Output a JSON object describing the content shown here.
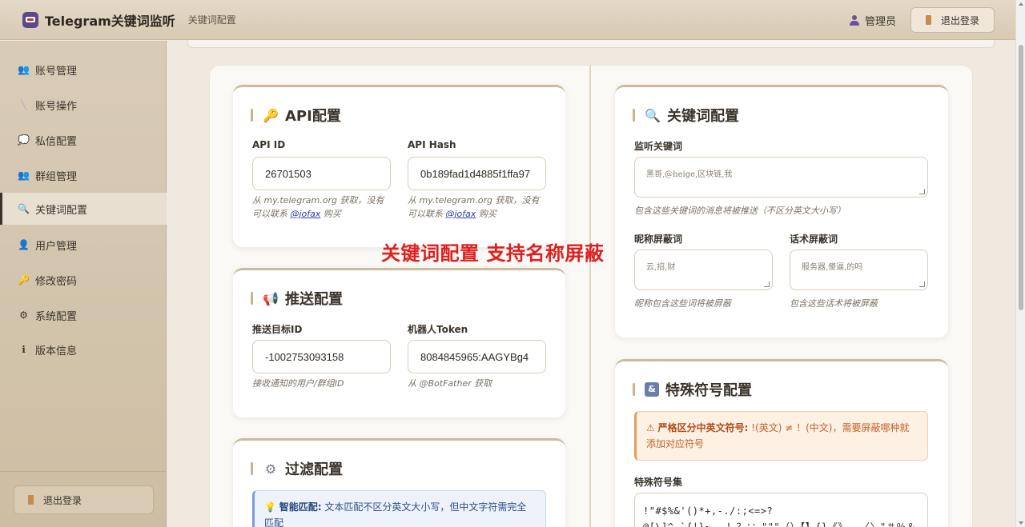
{
  "header": {
    "app_title": "Telegram关键词监听",
    "breadcrumb": "关键词配置",
    "user_name": "管理员",
    "logout_label": "退出登录"
  },
  "sidebar": {
    "items": [
      {
        "label": "账号管理",
        "icon": "users-icon"
      },
      {
        "label": "账号操作",
        "icon": "wand-icon"
      },
      {
        "label": "私信配置",
        "icon": "chat-icon"
      },
      {
        "label": "群组管理",
        "icon": "group-icon"
      },
      {
        "label": "关键词配置",
        "icon": "search-icon",
        "active": true
      },
      {
        "label": "用户管理",
        "icon": "user-icon"
      },
      {
        "label": "修改密码",
        "icon": "key-icon"
      },
      {
        "label": "系统配置",
        "icon": "gear-icon"
      },
      {
        "label": "版本信息",
        "icon": "info-icon"
      }
    ],
    "logout_label": "退出登录"
  },
  "api_card": {
    "title": "API配置",
    "api_id_label": "API ID",
    "api_id_value": "26701503",
    "api_hash_label": "API Hash",
    "api_hash_value": "0b189fad1d4885f1ffa97",
    "hint_prefix": "从 my.telegram.org 获取，没有可以联系",
    "hint_link": "@jofax",
    "hint_suffix": "购买"
  },
  "push_card": {
    "title": "推送配置",
    "target_label": "推送目标ID",
    "target_value": "-1002753093158",
    "target_hint": "接收通知的用户/群组ID",
    "token_label": "机器人Token",
    "token_value": "8084845965:AAGYBg4",
    "token_hint": "从 @BotFather 获取"
  },
  "filter_card": {
    "title": "过滤配置",
    "info_bold": "智能匹配:",
    "info_text": "文本匹配不区分英文大小写，但中文字符需完全匹配"
  },
  "keyword_card": {
    "title": "关键词配置",
    "listen_label": "监听关键词",
    "listen_placeholder": "黑哥,@heige,区块链,我",
    "listen_hint": "包含这些关键词的消息将被推送（不区分英文大小写）",
    "nick_label": "昵称屏蔽词",
    "nick_placeholder": "云,招,财",
    "nick_hint": "昵称包含这些词将被屏蔽",
    "phrase_label": "话术屏蔽词",
    "phrase_placeholder": "服务器,傻逼,的吗",
    "phrase_hint": "包含这些话术将被屏蔽"
  },
  "symbol_card": {
    "title": "特殊符号配置",
    "warn_bold": "严格区分中英文符号:",
    "warn_text": "!(英文) ≠ ！(中文)，需要屏蔽哪种就添加对应符号",
    "set_label": "特殊符号集",
    "set_value": "!\"#$%&'()*+,-./:;<=>?@[\\]^_`{|}~、。！？：；\"\"\"（）【】{}《》——〈〉\"＃％＆＠＊＄￥"
  },
  "overlay_caption": "关键词配置 支持名称屏蔽"
}
